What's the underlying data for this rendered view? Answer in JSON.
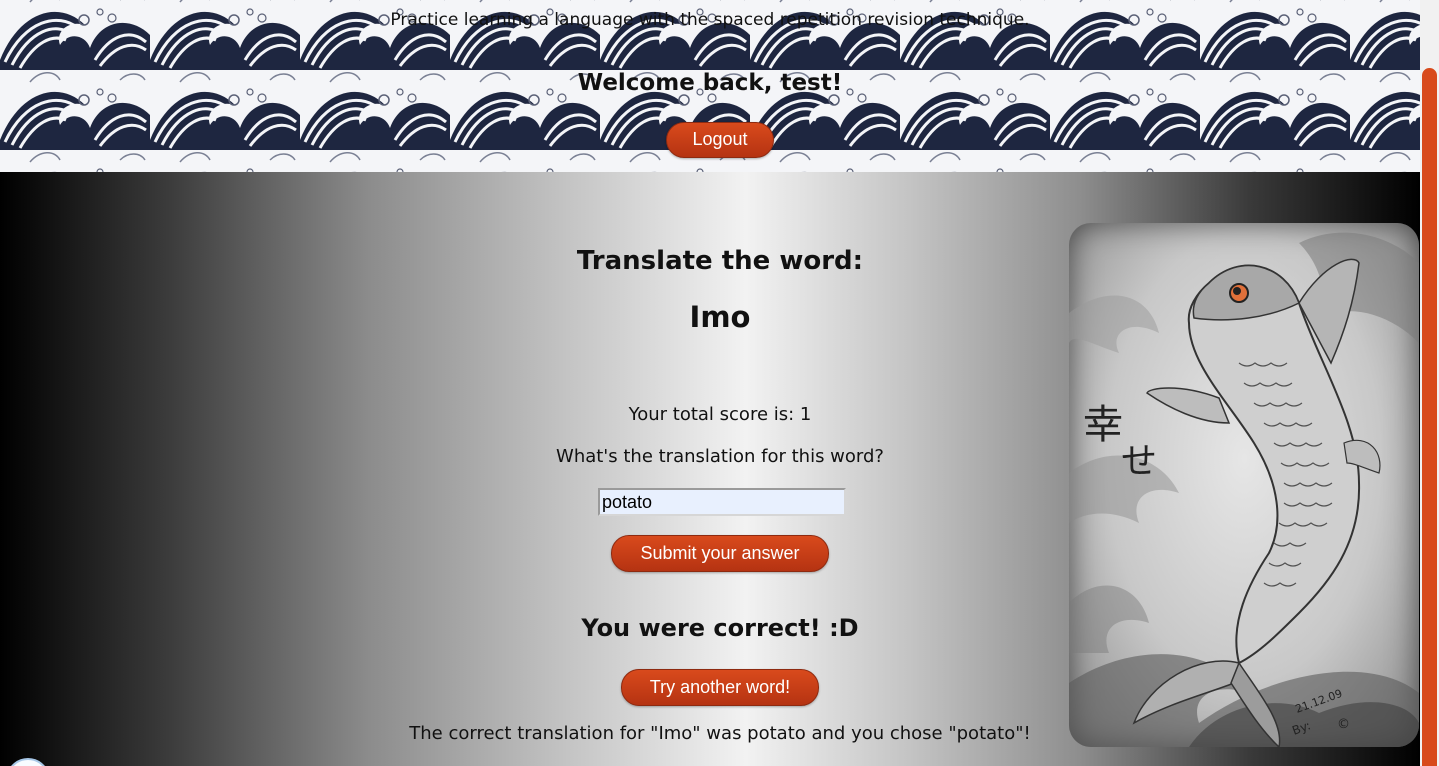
{
  "header": {
    "tagline": "Practice learning a language with the spaced repetition revision technique.",
    "welcome": "Welcome back, test!",
    "logout_label": "Logout"
  },
  "quiz": {
    "heading": "Translate the word:",
    "word": "Imo",
    "score_text": "Your total score is: 1",
    "question": "What's the translation for this word?",
    "answer_value": "potato",
    "submit_label": "Submit your answer",
    "result": "You were correct! :D",
    "another_label": "Try another word!",
    "feedback": "The correct translation for \"Imo\" was potato and you chose \"potato\"!"
  },
  "artwork": {
    "kanji_1": "幸",
    "kanji_2": "せ",
    "date": "21.12.09",
    "signature": "By:",
    "copyright": "©"
  },
  "colors": {
    "accent": "#d84a1b",
    "button_dark": "#b53312",
    "input_bg": "#e8f0fe"
  }
}
